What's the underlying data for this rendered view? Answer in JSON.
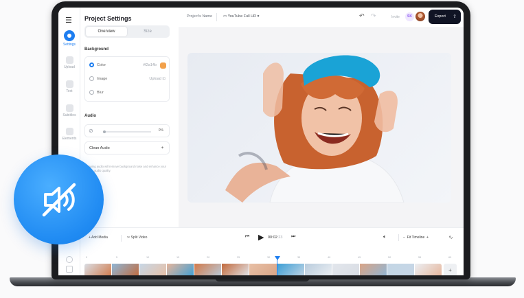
{
  "sidebar": {
    "items": [
      {
        "label": "Settings",
        "icon": "gear-icon",
        "active": true
      },
      {
        "label": "Upload",
        "icon": "upload-icon"
      },
      {
        "label": "Text",
        "icon": "text-icon"
      },
      {
        "label": "Subtitles",
        "icon": "subtitles-icon"
      },
      {
        "label": "Elements",
        "icon": "elements-icon"
      }
    ]
  },
  "panel": {
    "title": "Project Settings",
    "tabs": [
      "Overview",
      "Size"
    ],
    "background": {
      "heading": "Background",
      "options": [
        {
          "label": "Color",
          "value": "#f2a14b",
          "selected": true
        },
        {
          "label": "Image",
          "value": "Upload"
        },
        {
          "label": "Blur",
          "value": ""
        }
      ]
    },
    "audio": {
      "heading": "Audio",
      "volume": "0%",
      "clean_audio_label": "Clean Audio",
      "note": "Cleaning audio will remove background noise and enhance your video's audio quality."
    }
  },
  "topbar": {
    "project_name": "Project's Name",
    "format": "YouTube Full HD",
    "invite": "Invite",
    "user_initials": "SK",
    "export_label": "Export"
  },
  "timeline": {
    "add_media": "Add Media",
    "split_video": "Split Video",
    "current_time": "00:02",
    "time_suffix": ":23",
    "zoom_label": "Fit Timeline",
    "ruler": [
      "0",
      "5",
      "10",
      "15",
      "20",
      "25",
      "30",
      "35",
      "40",
      "45",
      "50",
      "55",
      "60"
    ],
    "add_clip": "+"
  },
  "colors": {
    "accent": "#1e7ef0",
    "export_bg": "#101424",
    "color_chip": "#f2a14b"
  }
}
